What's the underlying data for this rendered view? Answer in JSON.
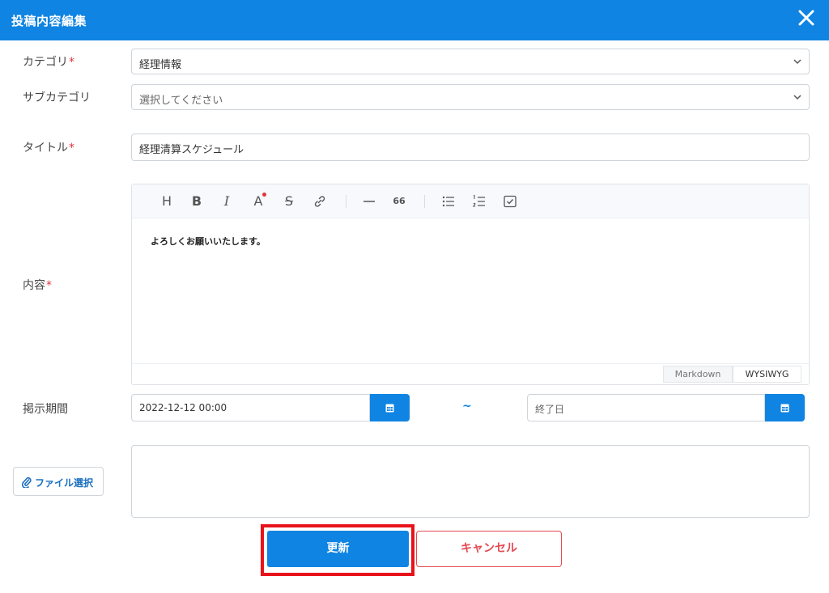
{
  "header": {
    "title": "投稿内容編集",
    "close_icon": "close-icon"
  },
  "form": {
    "category": {
      "label": "カテゴリ",
      "required": "*",
      "value": "経理情報"
    },
    "subcategory": {
      "label": "サブカテゴリ",
      "placeholder": "選択してください"
    },
    "title": {
      "label": "タイトル",
      "required": "*",
      "value": "経理清算スケジュール"
    },
    "content": {
      "label": "内容",
      "required": "*",
      "body": "よろしくお願いいたします。",
      "toolbar": [
        "heading-icon",
        "bold-icon",
        "italic-icon",
        "text-color-icon",
        "strikethrough-icon",
        "link-icon",
        "horizontal-rule-icon",
        "quote-icon",
        "bullet-list-icon",
        "ordered-list-icon",
        "task-list-icon"
      ],
      "toolbar_glyphs": {
        "heading": "H",
        "bold": "B",
        "italic": "I",
        "color": "A",
        "strike": "S",
        "quote": "66"
      },
      "modes": {
        "markdown": "Markdown",
        "wysiwyg": "WYSIWYG"
      }
    },
    "period": {
      "label": "掲示期間",
      "start_value": "2022-12-12 00:00",
      "separator": "~",
      "end_placeholder": "終了日"
    },
    "file": {
      "button_label": "ファイル選択"
    }
  },
  "actions": {
    "update_label": "更新",
    "cancel_label": "キャンセル"
  },
  "colors": {
    "primary": "#0f84e2",
    "required": "#e0333c",
    "cancel": "#e44a52",
    "highlight": "#e8121b"
  }
}
